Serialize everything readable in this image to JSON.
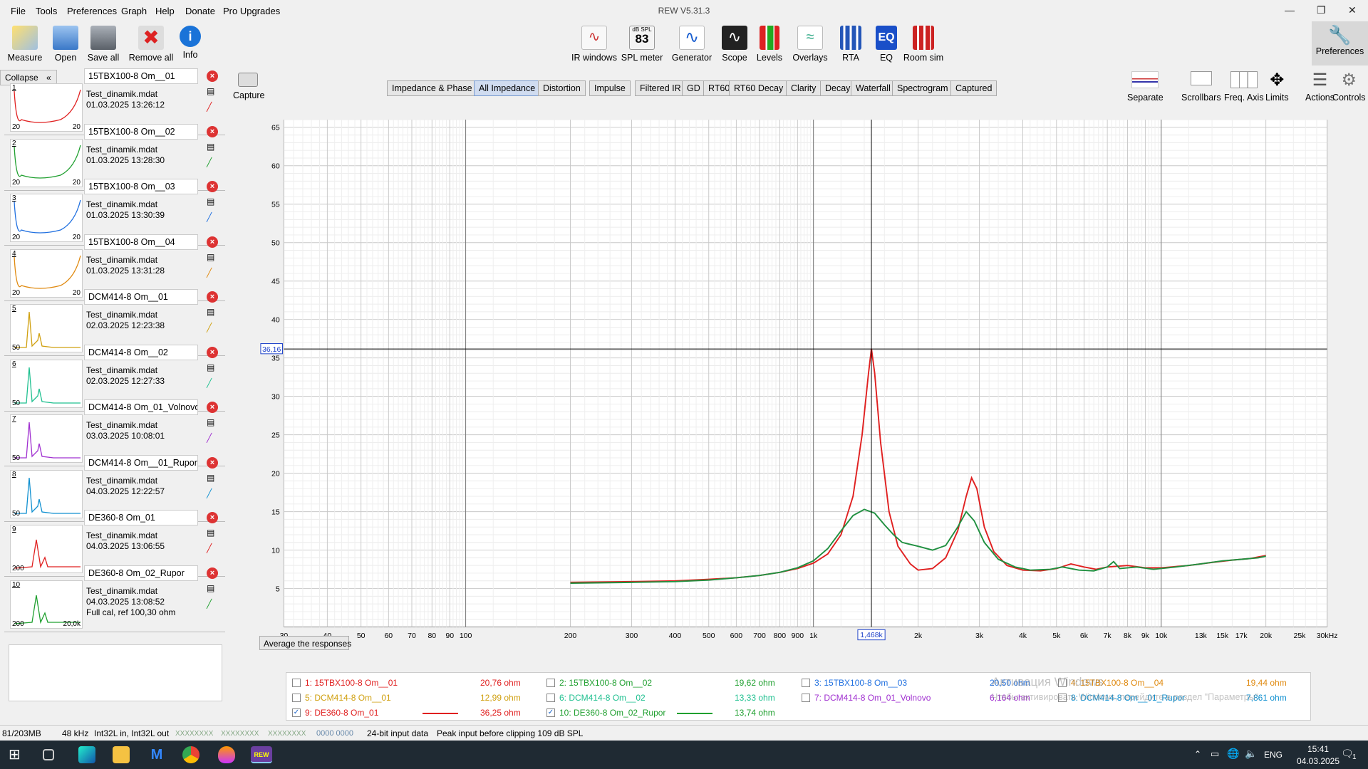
{
  "window": {
    "title": "REW V5.31.3"
  },
  "menu": [
    "File",
    "Tools",
    "Preferences",
    "Graph",
    "Help",
    "Donate",
    "Pro Upgrades"
  ],
  "toolbar_left": [
    {
      "label": "Measure",
      "icon": "measure-icon"
    },
    {
      "label": "Open",
      "icon": "folder-icon"
    },
    {
      "label": "Save all",
      "icon": "save-icon"
    },
    {
      "label": "Remove all",
      "icon": "remove-icon"
    },
    {
      "label": "Info",
      "icon": "info-icon"
    }
  ],
  "toolbar_center": [
    {
      "label": "IR windows",
      "icon": "ir-windows-icon"
    },
    {
      "label": "SPL meter",
      "icon": "spl-meter-icon",
      "badge_top": "dB SPL",
      "badge_val": "83"
    },
    {
      "label": "Generator",
      "icon": "generator-icon"
    },
    {
      "label": "Scope",
      "icon": "scope-icon"
    },
    {
      "label": "Levels",
      "icon": "levels-icon"
    },
    {
      "label": "Overlays",
      "icon": "overlays-icon"
    },
    {
      "label": "RTA",
      "icon": "rta-icon"
    },
    {
      "label": "EQ",
      "icon": "eq-icon"
    },
    {
      "label": "Room sim",
      "icon": "room-sim-icon"
    }
  ],
  "toolbar_right": {
    "label": "Preferences",
    "icon": "wrench-icon"
  },
  "collapse_label": "Collapse",
  "capture": {
    "label": "Capture"
  },
  "measurements": [
    {
      "num": "1",
      "name": "15TBX100-8 Om__01",
      "file": "Test_dinamik.mdat",
      "date": "01.03.2025 13:26:12",
      "fl": "20",
      "fr": "20",
      "color": "#e02020"
    },
    {
      "num": "2",
      "name": "15TBX100-8 Om__02",
      "file": "Test_dinamik.mdat",
      "date": "01.03.2025 13:28:30",
      "fl": "20",
      "fr": "20",
      "color": "#20a030"
    },
    {
      "num": "3",
      "name": "15TBX100-8 Om__03",
      "file": "Test_dinamik.mdat",
      "date": "01.03.2025 13:30:39",
      "fl": "20",
      "fr": "20",
      "color": "#2070e0"
    },
    {
      "num": "4",
      "name": "15TBX100-8 Om__04",
      "file": "Test_dinamik.mdat",
      "date": "01.03.2025 13:31:28",
      "fl": "20",
      "fr": "20",
      "color": "#e08a10"
    },
    {
      "num": "5",
      "name": "DCM414-8 Om__01",
      "file": "Test_dinamik.mdat",
      "date": "02.03.2025 12:23:38",
      "fl": "50",
      "fr": "",
      "color": "#d0a010"
    },
    {
      "num": "6",
      "name": "DCM414-8 Om__02",
      "file": "Test_dinamik.mdat",
      "date": "02.03.2025 12:27:33",
      "fl": "50",
      "fr": "",
      "color": "#20c090"
    },
    {
      "num": "7",
      "name": "DCM414-8 Om_01_Volnovo",
      "file": "Test_dinamik.mdat",
      "date": "03.03.2025 10:08:01",
      "fl": "50",
      "fr": "",
      "color": "#a030d0"
    },
    {
      "num": "8",
      "name": "DCM414-8 Om__01_Rupor",
      "file": "Test_dinamik.mdat",
      "date": "04.03.2025 12:22:57",
      "fl": "50",
      "fr": "",
      "color": "#1090d0"
    },
    {
      "num": "9",
      "name": "DE360-8 Om_01",
      "file": "Test_dinamik.mdat",
      "date": "04.03.2025 13:06:55",
      "fl": "200",
      "fr": "",
      "color": "#e02020"
    },
    {
      "num": "10",
      "name": "DE360-8 Om_02_Rupor",
      "file": "Test_dinamik.mdat",
      "date": "04.03.2025 13:08:52",
      "extra": "Full cal, ref 100,30 ohm",
      "fl": "200",
      "fr": "20,0k",
      "color": "#20a030"
    }
  ],
  "tabs": [
    "Impedance & Phase",
    "All Impedance",
    "Distortion",
    "Impulse",
    "Filtered IR",
    "GD",
    "RT60",
    "RT60 Decay",
    "Clarity",
    "Decay",
    "Waterfall",
    "Spectrogram",
    "Captured"
  ],
  "selected_tab": "All Impedance",
  "graph_tools": [
    {
      "label": "Separate",
      "icon": "separate-icon"
    },
    {
      "label": "Scrollbars",
      "icon": "scrollbars-icon"
    },
    {
      "label": "Freq. Axis",
      "icon": "freq-axis-icon"
    },
    {
      "label": "Limits",
      "icon": "limits-icon"
    },
    {
      "label": "Actions",
      "icon": "actions-icon"
    },
    {
      "label": "Controls",
      "icon": "controls-icon"
    }
  ],
  "chart_data": {
    "type": "line",
    "ylabel": "ohm",
    "xscale": "log",
    "xlim": [
      30,
      30000
    ],
    "ylim": [
      0,
      66
    ],
    "yticks": [
      5,
      10,
      15,
      20,
      25,
      30,
      35,
      40,
      45,
      50,
      55,
      60,
      65
    ],
    "xticks": [
      {
        "v": 30,
        "t": "30"
      },
      {
        "v": 40,
        "t": "40"
      },
      {
        "v": 50,
        "t": "50"
      },
      {
        "v": 60,
        "t": "60"
      },
      {
        "v": 70,
        "t": "70"
      },
      {
        "v": 80,
        "t": "80"
      },
      {
        "v": 90,
        "t": "90"
      },
      {
        "v": 100,
        "t": "100"
      },
      {
        "v": 200,
        "t": "200"
      },
      {
        "v": 300,
        "t": "300"
      },
      {
        "v": 400,
        "t": "400"
      },
      {
        "v": 500,
        "t": "500"
      },
      {
        "v": 600,
        "t": "600"
      },
      {
        "v": 700,
        "t": "700"
      },
      {
        "v": 800,
        "t": "800"
      },
      {
        "v": 900,
        "t": "900"
      },
      {
        "v": 1000,
        "t": "1k"
      },
      {
        "v": 2000,
        "t": "2k"
      },
      {
        "v": 3000,
        "t": "3k"
      },
      {
        "v": 4000,
        "t": "4k"
      },
      {
        "v": 5000,
        "t": "5k"
      },
      {
        "v": 6000,
        "t": "6k"
      },
      {
        "v": 7000,
        "t": "7k"
      },
      {
        "v": 8000,
        "t": "8k"
      },
      {
        "v": 9000,
        "t": "9k"
      },
      {
        "v": 10000,
        "t": "10k"
      },
      {
        "v": 13000,
        "t": "13k"
      },
      {
        "v": 15000,
        "t": "15k"
      },
      {
        "v": 17000,
        "t": "17k"
      },
      {
        "v": 20000,
        "t": "20k"
      },
      {
        "v": 25000,
        "t": "25k"
      },
      {
        "v": 30000,
        "t": "30kHz"
      }
    ],
    "cursor": {
      "x": 1468,
      "x_label": "1,468k",
      "y": 36.16,
      "y_label": "36,16"
    },
    "series": [
      {
        "name": "9: DE360-8 Om_01",
        "color": "#e02020",
        "points": [
          [
            200,
            5.8
          ],
          [
            300,
            5.9
          ],
          [
            400,
            6.0
          ],
          [
            500,
            6.2
          ],
          [
            600,
            6.4
          ],
          [
            700,
            6.7
          ],
          [
            800,
            7.1
          ],
          [
            900,
            7.6
          ],
          [
            1000,
            8.3
          ],
          [
            1100,
            9.5
          ],
          [
            1200,
            12
          ],
          [
            1300,
            17
          ],
          [
            1380,
            25
          ],
          [
            1440,
            33
          ],
          [
            1468,
            36.2
          ],
          [
            1500,
            33
          ],
          [
            1560,
            24
          ],
          [
            1650,
            15
          ],
          [
            1750,
            10.5
          ],
          [
            1900,
            8.2
          ],
          [
            2000,
            7.4
          ],
          [
            2200,
            7.6
          ],
          [
            2400,
            9
          ],
          [
            2600,
            12.5
          ],
          [
            2750,
            17
          ],
          [
            2850,
            19.4
          ],
          [
            2950,
            18
          ],
          [
            3100,
            13
          ],
          [
            3300,
            9.8
          ],
          [
            3600,
            8.0
          ],
          [
            4000,
            7.4
          ],
          [
            4500,
            7.3
          ],
          [
            5000,
            7.6
          ],
          [
            5500,
            8.2
          ],
          [
            6000,
            7.8
          ],
          [
            6500,
            7.5
          ],
          [
            7000,
            7.8
          ],
          [
            8000,
            8.0
          ],
          [
            9000,
            7.7
          ],
          [
            10000,
            7.7
          ],
          [
            12000,
            8.0
          ],
          [
            14000,
            8.4
          ],
          [
            16000,
            8.7
          ],
          [
            18000,
            8.9
          ],
          [
            20000,
            9.3
          ]
        ]
      },
      {
        "name": "10: DE360-8 Om_02_Rupor",
        "color": "#209040",
        "points": [
          [
            200,
            5.7
          ],
          [
            300,
            5.8
          ],
          [
            400,
            5.9
          ],
          [
            500,
            6.1
          ],
          [
            600,
            6.4
          ],
          [
            700,
            6.7
          ],
          [
            800,
            7.1
          ],
          [
            900,
            7.7
          ],
          [
            1000,
            8.6
          ],
          [
            1100,
            10.2
          ],
          [
            1200,
            12.5
          ],
          [
            1300,
            14.5
          ],
          [
            1400,
            15.3
          ],
          [
            1500,
            14.8
          ],
          [
            1600,
            13.3
          ],
          [
            1700,
            12.0
          ],
          [
            1800,
            11.0
          ],
          [
            2000,
            10.5
          ],
          [
            2200,
            10.0
          ],
          [
            2400,
            10.6
          ],
          [
            2600,
            13
          ],
          [
            2750,
            15.0
          ],
          [
            2900,
            13.8
          ],
          [
            3100,
            11.0
          ],
          [
            3400,
            8.8
          ],
          [
            3800,
            7.8
          ],
          [
            4200,
            7.4
          ],
          [
            4800,
            7.5
          ],
          [
            5200,
            7.8
          ],
          [
            5800,
            7.4
          ],
          [
            6400,
            7.3
          ],
          [
            7000,
            7.8
          ],
          [
            7300,
            8.5
          ],
          [
            7600,
            7.6
          ],
          [
            8500,
            7.8
          ],
          [
            9500,
            7.5
          ],
          [
            11000,
            7.8
          ],
          [
            13000,
            8.2
          ],
          [
            15000,
            8.6
          ],
          [
            17000,
            8.8
          ],
          [
            19000,
            9.0
          ],
          [
            20000,
            9.2
          ]
        ]
      }
    ]
  },
  "average_button": "Average the responses",
  "legend": [
    {
      "checked": false,
      "label": "1: 15TBX100-8 Om__01",
      "value": "20,76 ohm",
      "color": "#e02020",
      "line": false
    },
    {
      "checked": false,
      "label": "2: 15TBX100-8 Om__02",
      "value": "19,62 ohm",
      "color": "#20a030",
      "line": false
    },
    {
      "checked": false,
      "label": "3: 15TBX100-8 Om__03",
      "value": "20,50 ohm",
      "color": "#2070e0",
      "line": false
    },
    {
      "checked": false,
      "label": "4: 15TBX100-8 Om__04",
      "value": "19,44 ohm",
      "color": "#e08a10",
      "line": false
    },
    {
      "checked": false,
      "label": "5: DCM414-8 Om__01",
      "value": "12,99 ohm",
      "color": "#d0a010",
      "line": false
    },
    {
      "checked": false,
      "label": "6: DCM414-8 Om__02",
      "value": "13,33 ohm",
      "color": "#20c090",
      "line": false
    },
    {
      "checked": false,
      "label": "7: DCM414-8 Om_01_Volnovo",
      "value": "6,164 ohm",
      "color": "#a030d0",
      "line": false
    },
    {
      "checked": false,
      "label": "8: DCM414-8 Om__01_Rupor",
      "value": "7,861 ohm",
      "color": "#1090d0",
      "line": false
    },
    {
      "checked": true,
      "label": "9: DE360-8 Om_01",
      "value": "36,25 ohm",
      "color": "#e02020",
      "line": true
    },
    {
      "checked": true,
      "label": "10: DE360-8 Om_02_Rupor",
      "value": "13,74 ohm",
      "color": "#20a030",
      "line": true
    }
  ],
  "watermark": {
    "line1": "Активация Windows",
    "line2": "Чтобы активировать Windows, перейдите в раздел \"Параметры\"."
  },
  "status": {
    "memory": "81/203MB",
    "rate": "48 kHz",
    "io": "Int32L in, Int32L out",
    "lvl1": "XXXXXXXX",
    "lvl2": "XXXXXXXX",
    "lvl3": "XXXXXXXX",
    "lvl4": "0000 0000",
    "bits": "24-bit input data",
    "peak": "Peak input before clipping 109 dB SPL"
  },
  "taskbar": {
    "lang": "ENG",
    "time": "15:41",
    "date": "04.03.2025",
    "notif": "1"
  }
}
